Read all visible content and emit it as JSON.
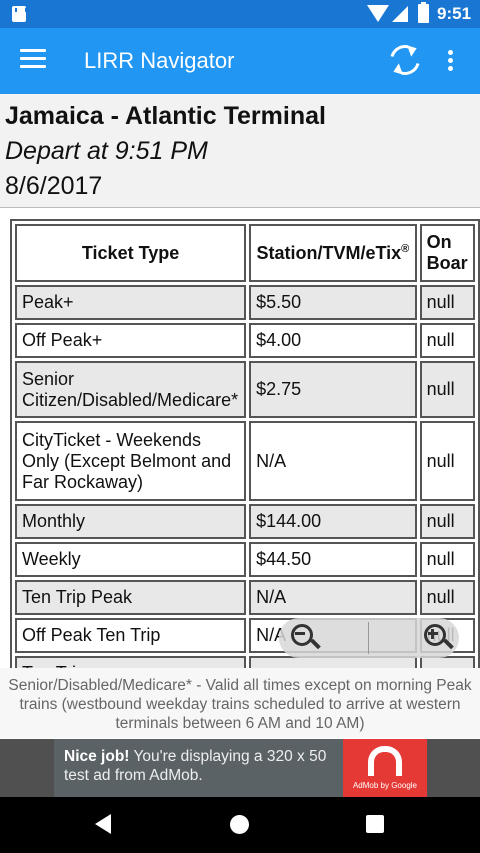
{
  "status_bar": {
    "time": "9:51"
  },
  "app_bar": {
    "title": "LIRR Navigator"
  },
  "trip": {
    "route": "Jamaica - Atlantic Terminal",
    "depart": "Depart at 9:51 PM",
    "date": "8/6/2017"
  },
  "fare_table": {
    "headers": {
      "ticket_type": "Ticket Type",
      "station": "Station/TVM/eTix",
      "station_sup": "®",
      "onboard_line1": "On",
      "onboard_line2": "Boar"
    },
    "rows": [
      {
        "type": "Peak+",
        "station": "$5.50",
        "onboard": "null"
      },
      {
        "type": "Off Peak+",
        "station": "$4.00",
        "onboard": "null"
      },
      {
        "type": "Senior Citizen/Disabled/Medicare*",
        "station": "$2.75",
        "onboard": "null"
      },
      {
        "type": "CityTicket - Weekends Only (Except Belmont and Far Rockaway)",
        "station": "N/A",
        "onboard": "null"
      },
      {
        "type": "Monthly",
        "station": "$144.00",
        "onboard": "null"
      },
      {
        "type": "Weekly",
        "station": "$44.50",
        "onboard": "null"
      },
      {
        "type": "Ten Trip Peak",
        "station": "N/A",
        "onboard": "null"
      },
      {
        "type": "Off Peak Ten Trip",
        "station": "N/A",
        "onboard": "null"
      },
      {
        "type": "Ten Trip",
        "station": "",
        "onboard": ""
      }
    ]
  },
  "footnote": "Senior/Disabled/Medicare* - Valid all times except on morning Peak trains (westbound weekday trains scheduled to arrive at western terminals between 6 AM and 10 AM)",
  "ad": {
    "bold": "Nice job!",
    "text": " You're displaying a 320 x 50 test ad from AdMob.",
    "logo_caption": "AdMob by Google"
  }
}
